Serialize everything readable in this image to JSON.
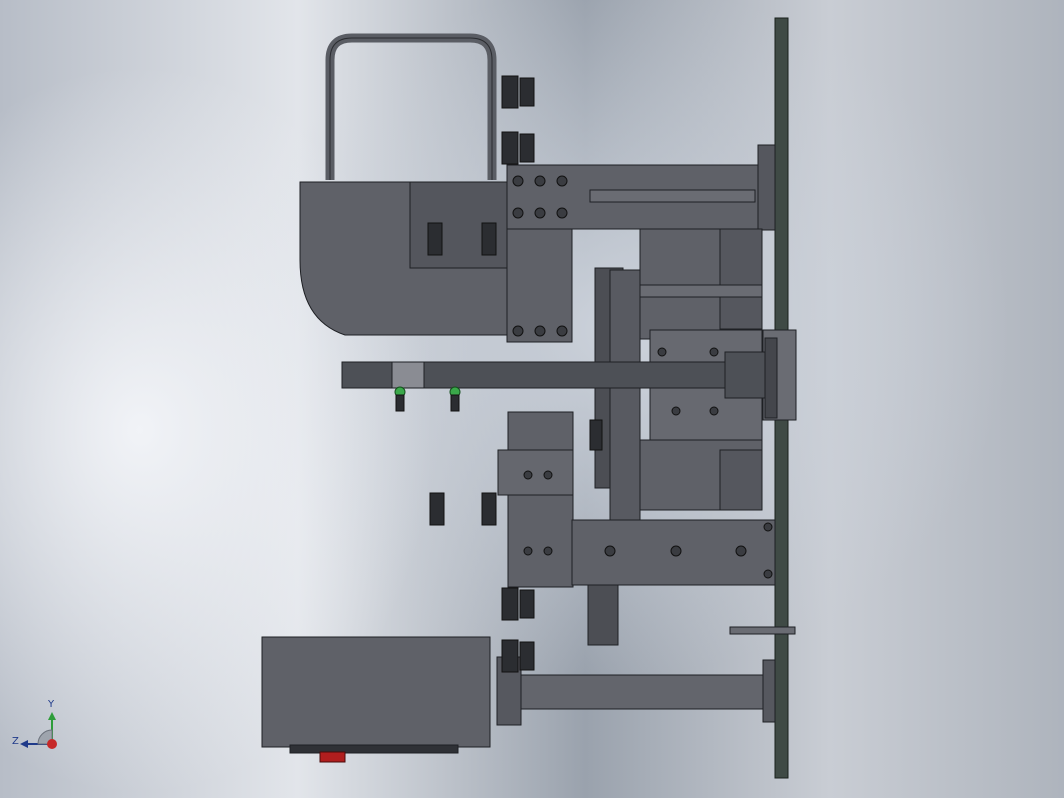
{
  "viewport": {
    "view": "front",
    "background": [
      "#b7bdc7",
      "#e2e5ea",
      "#9aa2ad"
    ]
  },
  "model": {
    "body_color": "#5f6168",
    "edge_color": "#1e2024",
    "plate_color": "#3f4a45",
    "fitting_color": "#2b2d31",
    "accent_green": "#3aa84a",
    "accent_red": "#b01e1e"
  },
  "triad": {
    "x_label": "X",
    "y_label": "Y",
    "z_label": "Z",
    "x_color": "#c62828",
    "y_color": "#2e9d3a",
    "z_color": "#1f3a8a"
  }
}
